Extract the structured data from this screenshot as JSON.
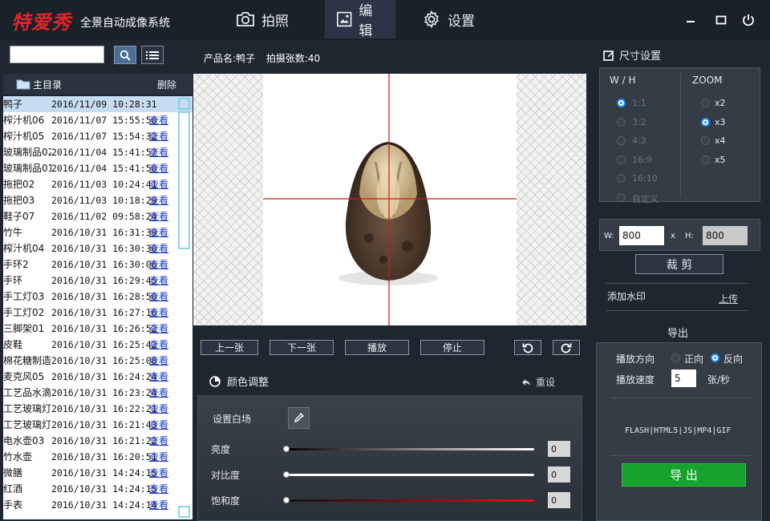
{
  "app": {
    "logo": "特爱秀",
    "subtitle": "全景自动成像系统"
  },
  "nav": {
    "tabs": [
      {
        "label": "拍照"
      },
      {
        "label": "编辑"
      },
      {
        "label": "设置"
      }
    ]
  },
  "search": {
    "value": "",
    "placeholder": ""
  },
  "directory": {
    "title": "主目录",
    "delete_label": "删除"
  },
  "files": [
    {
      "name": "鸭子",
      "date": "2016/11/09 10:28:31",
      "view": ""
    },
    {
      "name": "榨汁机06",
      "date": "2016/11/07 15:55:50",
      "view": "查看"
    },
    {
      "name": "榨汁机05",
      "date": "2016/11/07 15:54:32",
      "view": "查看"
    },
    {
      "name": "玻璃制品02",
      "date": "2016/11/04 15:41:57",
      "view": "查看"
    },
    {
      "name": "玻璃制品01",
      "date": "2016/11/04 15:41:50",
      "view": "查看"
    },
    {
      "name": "拖把02",
      "date": "2016/11/03 10:24:41",
      "view": "查看"
    },
    {
      "name": "拖把03",
      "date": "2016/11/03 10:18:29",
      "view": "查看"
    },
    {
      "name": "鞋子07",
      "date": "2016/11/02 09:58:24",
      "view": "查看"
    },
    {
      "name": "竹牛",
      "date": "2016/10/31 16:31:39",
      "view": "查看"
    },
    {
      "name": "榨汁机04",
      "date": "2016/10/31 16:30:30",
      "view": "查看"
    },
    {
      "name": "手环2",
      "date": "2016/10/31 16:30:06",
      "view": "查看"
    },
    {
      "name": "手环",
      "date": "2016/10/31 16:29:45",
      "view": "查看"
    },
    {
      "name": "手工灯03",
      "date": "2016/10/31 16:28:50",
      "view": "查看"
    },
    {
      "name": "手工灯02",
      "date": "2016/10/31 16:27:16",
      "view": "查看"
    },
    {
      "name": "三脚架01",
      "date": "2016/10/31 16:26:52",
      "view": "查看"
    },
    {
      "name": "皮鞋",
      "date": "2016/10/31 16:25:42",
      "view": "查看"
    },
    {
      "name": "棉花糖制造",
      "date": "2016/10/31 16:25:08",
      "view": "查看"
    },
    {
      "name": "麦克风05",
      "date": "2016/10/31 16:24:24",
      "view": "查看"
    },
    {
      "name": "工艺品水滴",
      "date": "2016/10/31 16:23:24",
      "view": "查看"
    },
    {
      "name": "工艺玻璃灯",
      "date": "2016/10/31 16:22:21",
      "view": "查看"
    },
    {
      "name": "工艺玻璃灯",
      "date": "2016/10/31 16:21:43",
      "view": "查看"
    },
    {
      "name": "电水壶03",
      "date": "2016/10/31 16:21:22",
      "view": "查看"
    },
    {
      "name": "竹水壶",
      "date": "2016/10/31 16:20:51",
      "view": "查看"
    },
    {
      "name": "微膳",
      "date": "2016/10/31 14:24:15",
      "view": "查看"
    },
    {
      "name": "红酒",
      "date": "2016/10/31 14:24:15",
      "view": "查看"
    },
    {
      "name": "手表",
      "date": "2016/10/31 14:24:14",
      "view": "查看"
    }
  ],
  "product": {
    "name_label": "产品名:鸭子",
    "count_label": "拍摄张数:40"
  },
  "playback": {
    "prev": "上一张",
    "next": "下一张",
    "play": "播放",
    "stop": "停止"
  },
  "color": {
    "title": "颜色调整",
    "reset": "重设",
    "white_point": "设置白场",
    "sliders": [
      {
        "label": "亮度",
        "value": "0",
        "level": 0
      },
      {
        "label": "对比度",
        "value": "0",
        "level": 0
      },
      {
        "label": "饱和度",
        "value": "0",
        "level": 0
      }
    ]
  },
  "size": {
    "title": "尺寸设置",
    "wh_header": "W / H",
    "zoom_header": "ZOOM",
    "ratios": [
      {
        "label": "1:1",
        "checked": true
      },
      {
        "label": "3:2",
        "checked": false
      },
      {
        "label": "4:3",
        "checked": false
      },
      {
        "label": "16:9",
        "checked": false
      },
      {
        "label": "16:10",
        "checked": false
      },
      {
        "label": "自定义",
        "checked": false
      }
    ],
    "zooms": [
      {
        "label": "x2",
        "checked": false
      },
      {
        "label": "x3",
        "checked": true
      },
      {
        "label": "x4",
        "checked": false
      },
      {
        "label": "x5",
        "checked": false
      }
    ],
    "w_label": "W:",
    "w_value": "800",
    "x_label": "x",
    "h_label": "H:",
    "h_value": "800",
    "crop_label": "裁 剪"
  },
  "watermark": {
    "label": "添加水印",
    "upload": "上传"
  },
  "export": {
    "title": "导出",
    "direction_label": "播放方向",
    "forward": "正向",
    "reverse": "反向",
    "speed_label": "播放速度",
    "speed_value": "5",
    "speed_unit": "张/秒",
    "formats": "FLASH|HTML5|JS|MP4|GIF",
    "button": "导 出"
  },
  "colors": {
    "accent": "#1a8cff",
    "logo_red": "#e0242c",
    "export_green": "#16a22c",
    "crosshair": "#d01818"
  }
}
